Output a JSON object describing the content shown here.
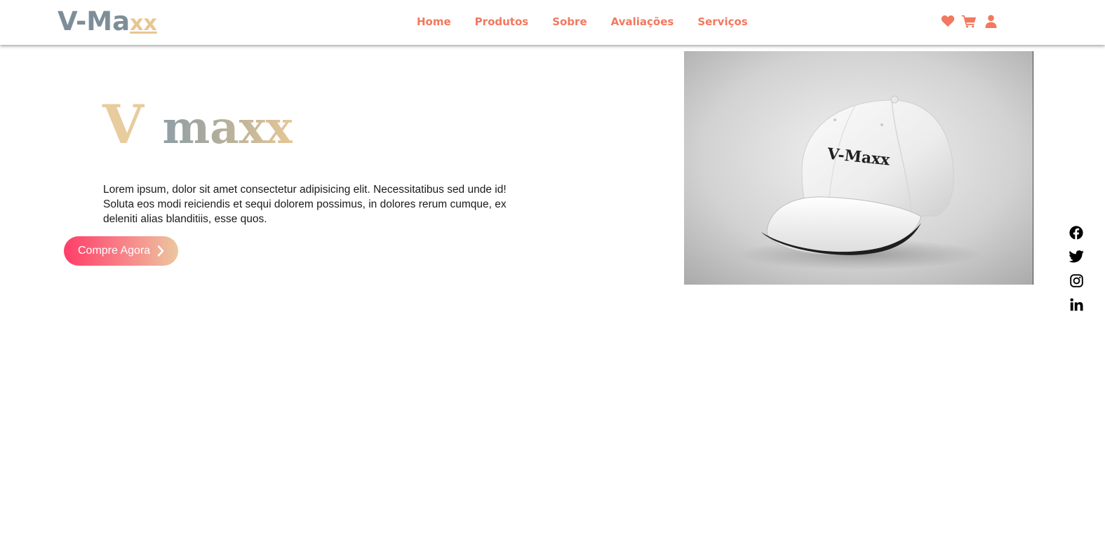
{
  "header": {
    "logo_main": "V-Ma",
    "logo_accent": "xx",
    "nav": [
      {
        "label": "Home"
      },
      {
        "label": "Produtos"
      },
      {
        "label": "Sobre"
      },
      {
        "label": "Avaliações"
      },
      {
        "label": "Serviços"
      }
    ],
    "icons": [
      "heart-icon",
      "cart-icon",
      "user-icon"
    ]
  },
  "hero": {
    "title_v": "V",
    "title_rest": "maxx",
    "description": "Lorem ipsum, dolor sit amet consectetur adipisicing elit. Necessitatibus sed unde id! Soluta eos modi reiciendis et sequi dolorem possimus, in dolores rerum cumque, ex deleniti alias blanditiis, esse quos.",
    "button_label": "Compre Agora",
    "product_cap_text": "V-Maxx"
  },
  "social": [
    "facebook-icon",
    "twitter-icon",
    "instagram-icon",
    "linkedin-icon"
  ],
  "colors": {
    "accent": "#f2785f",
    "logo_gray": "#7e8e99",
    "logo_gold": "#e7c691",
    "button_start": "#ff3e68",
    "button_end": "#ecc79f"
  }
}
